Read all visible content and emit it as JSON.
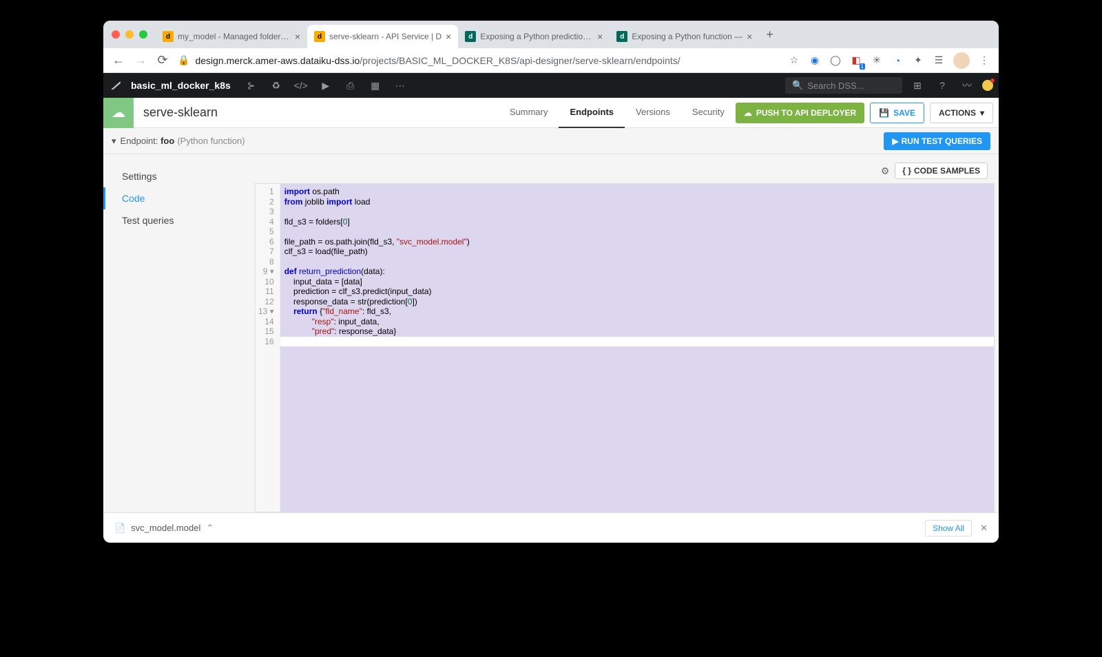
{
  "browser": {
    "tabs": [
      {
        "title": "my_model - Managed folder | D",
        "fav": "d",
        "favClass": "fav-orange"
      },
      {
        "title": "serve-sklearn - API Service | D",
        "fav": "d",
        "favClass": "fav-orange",
        "active": true
      },
      {
        "title": "Exposing a Python prediction m",
        "fav": "d",
        "favClass": "fav-teal"
      },
      {
        "title": "Exposing a Python function —",
        "fav": "d",
        "favClass": "fav-teal"
      }
    ],
    "url_prefix": "design.merck.amer-aws.dataiku-dss.io",
    "url_path": "/projects/BASIC_ML_DOCKER_K8S/api-designer/serve-sklearn/endpoints/"
  },
  "dss": {
    "project": "basic_ml_docker_k8s",
    "search_placeholder": "Search DSS..."
  },
  "page": {
    "title": "serve-sklearn",
    "tabs": {
      "summary": "Summary",
      "endpoints": "Endpoints",
      "versions": "Versions",
      "security": "Security"
    },
    "push_btn": "PUSH TO API DEPLOYER",
    "save_btn": "SAVE",
    "actions_btn": "ACTIONS"
  },
  "endpoint": {
    "label": "Endpoint:",
    "name": "foo",
    "type": "(Python function)",
    "run_btn": "RUN TEST QUERIES"
  },
  "sidebar": {
    "settings": "Settings",
    "code": "Code",
    "test_queries": "Test queries"
  },
  "toolbar": {
    "code_samples": "CODE SAMPLES"
  },
  "code": {
    "gutter": [
      "1",
      "2",
      "3",
      "4",
      "5",
      "6",
      "7",
      "8",
      "9 ▾",
      "10",
      "11",
      "12",
      "13 ▾",
      "14",
      "15",
      "16"
    ],
    "lines": [
      [
        [
          "kw",
          "import"
        ],
        [
          "",
          " os.path"
        ]
      ],
      [
        [
          "kw",
          "from"
        ],
        [
          "",
          " joblib "
        ],
        [
          "kw",
          "import"
        ],
        [
          "",
          " load"
        ]
      ],
      [],
      [
        [
          "",
          "fld_s3 = folders["
        ],
        [
          "num",
          "0"
        ],
        [
          "",
          "]"
        ]
      ],
      [],
      [
        [
          "",
          "file_path = os.path.join(fld_s3, "
        ],
        [
          "str",
          "\"svc_model.model\""
        ],
        [
          "",
          ")"
        ]
      ],
      [
        [
          "",
          "clf_s3 = load(file_path)"
        ]
      ],
      [],
      [
        [
          "kw",
          "def "
        ],
        [
          "fn",
          "return_prediction"
        ],
        [
          "",
          "(data):"
        ]
      ],
      [
        [
          "",
          "    input_data = [data]"
        ]
      ],
      [
        [
          "",
          "    prediction = clf_s3.predict(input_data)"
        ]
      ],
      [
        [
          "",
          "    response_data = str(prediction["
        ],
        [
          "num",
          "0"
        ],
        [
          "",
          "])"
        ]
      ],
      [
        [
          "",
          "    "
        ],
        [
          "kw",
          "return"
        ],
        [
          "",
          " {"
        ],
        [
          "str",
          "\"fld_name\""
        ],
        [
          "",
          ": fld_s3,"
        ]
      ],
      [
        [
          "",
          "            "
        ],
        [
          "str",
          "\"resp\""
        ],
        [
          "",
          ": input_data,"
        ]
      ],
      [
        [
          "",
          "            "
        ],
        [
          "str",
          "\"pred\""
        ],
        [
          "",
          ": response_data}"
        ]
      ],
      []
    ],
    "unselectedLine": 15
  },
  "bottom": {
    "file": "svc_model.model",
    "show_all": "Show All"
  }
}
